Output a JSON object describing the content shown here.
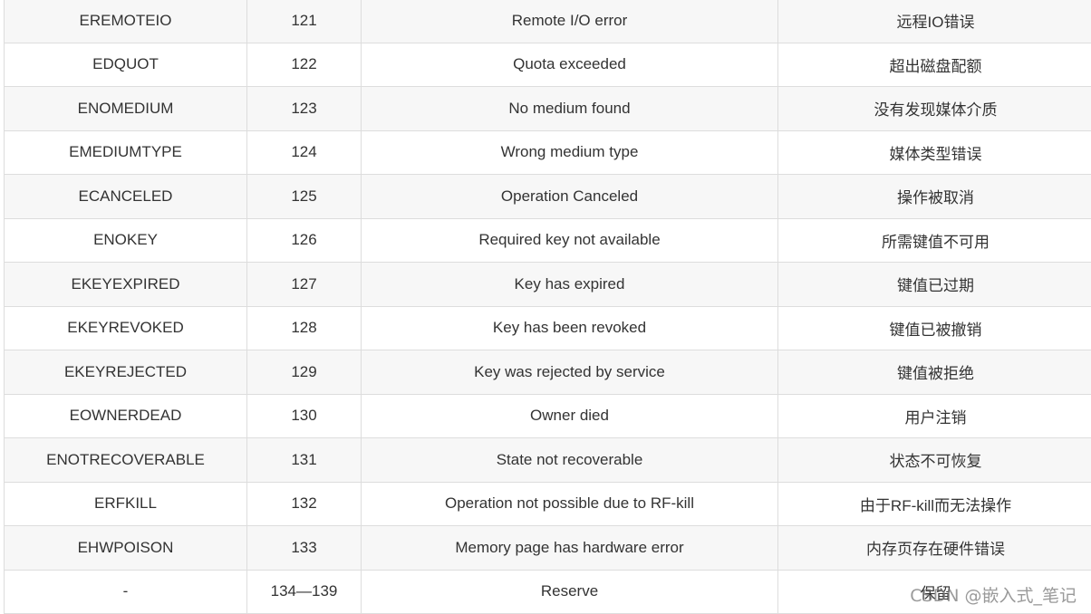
{
  "rows": [
    [
      "EREMOTEIO",
      "121",
      "Remote I/O error",
      "远程IO错误"
    ],
    [
      "EDQUOT",
      "122",
      "Quota exceeded",
      "超出磁盘配额"
    ],
    [
      "ENOMEDIUM",
      "123",
      "No medium found",
      "没有发现媒体介质"
    ],
    [
      "EMEDIUMTYPE",
      "124",
      "Wrong medium type",
      "媒体类型错误"
    ],
    [
      "ECANCELED",
      "125",
      "Operation Canceled",
      "操作被取消"
    ],
    [
      "ENOKEY",
      "126",
      "Required key not available",
      "所需键值不可用"
    ],
    [
      "EKEYEXPIRED",
      "127",
      "Key has expired",
      "键值已过期"
    ],
    [
      "EKEYREVOKED",
      "128",
      "Key has been revoked",
      "键值已被撤销"
    ],
    [
      "EKEYREJECTED",
      "129",
      "Key was rejected by service",
      "键值被拒绝"
    ],
    [
      "EOWNERDEAD",
      "130",
      "Owner died",
      "用户注销"
    ],
    [
      "ENOTRECOVERABLE",
      "131",
      "State not recoverable",
      "状态不可恢复"
    ],
    [
      "ERFKILL",
      "132",
      "Operation not possible due to RF-kill",
      "由于RF-kill而无法操作"
    ],
    [
      "EHWPOISON",
      "133",
      "Memory page has hardware error",
      "内存页存在硬件错误"
    ],
    [
      "-",
      "134—139",
      "Reserve",
      "保留"
    ]
  ],
  "watermark": "CSDN @嵌入式_笔记"
}
